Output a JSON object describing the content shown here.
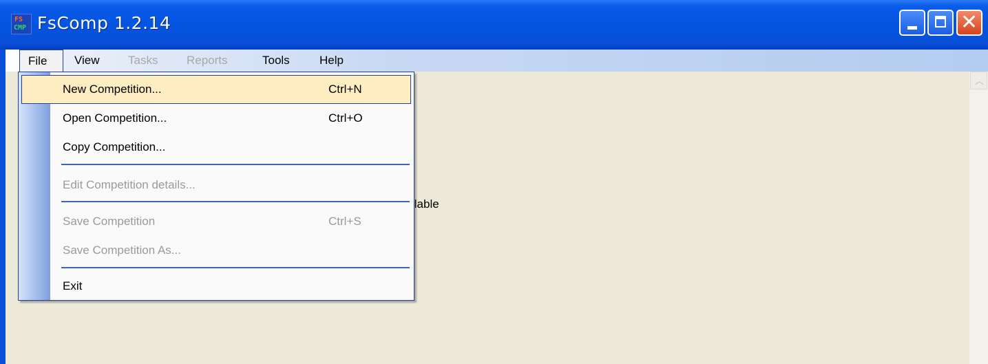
{
  "window": {
    "title": "FsComp 1.2.14",
    "icon_text": [
      "FS",
      "CMP"
    ],
    "controls": [
      "minimize-icon",
      "maximize-icon",
      "close-icon"
    ]
  },
  "menubar": {
    "items": [
      {
        "label": "File",
        "state": "open"
      },
      {
        "label": "View",
        "state": "enabled"
      },
      {
        "label": "Tasks",
        "state": "disabled"
      },
      {
        "label": "Reports",
        "state": "disabled"
      },
      {
        "label": "Tools",
        "state": "enabled"
      },
      {
        "label": "Help",
        "state": "enabled"
      }
    ]
  },
  "file_menu": {
    "items": [
      {
        "label": "New Competition...",
        "shortcut": "Ctrl+N",
        "state": "highlighted"
      },
      {
        "label": "Open Competition...",
        "shortcut": "Ctrl+O",
        "state": "enabled"
      },
      {
        "label": "Copy Competition...",
        "shortcut": "",
        "state": "enabled"
      },
      {
        "label": "Edit Competition details...",
        "shortcut": "",
        "state": "disabled"
      },
      {
        "label": "Save Competition",
        "shortcut": "Ctrl+S",
        "state": "disabled"
      },
      {
        "label": "Save Competition As...",
        "shortcut": "",
        "state": "disabled"
      },
      {
        "label": "Exit",
        "shortcut": "",
        "state": "enabled"
      }
    ]
  },
  "background": {
    "partial_text": "ilable"
  },
  "colors": {
    "titlebar": "#0a4fd8",
    "menu_highlight": "#ffedc2",
    "menu_border": "#1f3f9a",
    "client_background": "#ece9d8",
    "close_button": "#d8431e"
  }
}
